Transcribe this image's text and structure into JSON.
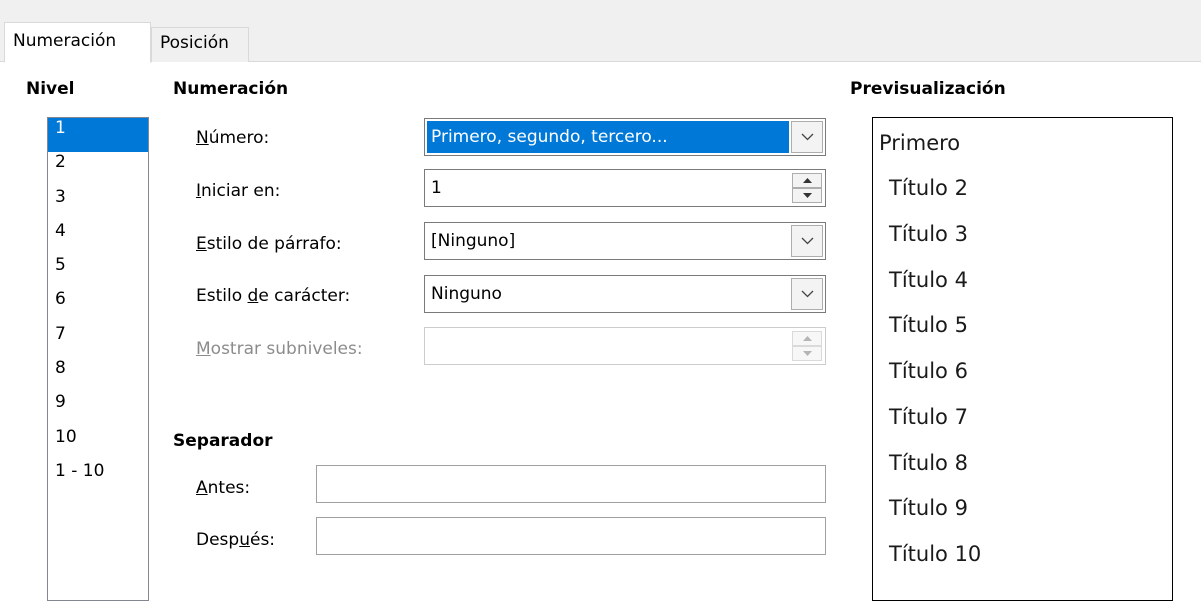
{
  "tabs": [
    {
      "label": "Numeración",
      "active": true
    },
    {
      "label": "Posición",
      "active": false
    }
  ],
  "level": {
    "heading": "Nivel",
    "items": [
      "1",
      "2",
      "3",
      "4",
      "5",
      "6",
      "7",
      "8",
      "9",
      "10",
      "1 - 10"
    ],
    "selected": "1"
  },
  "numbering": {
    "heading": "Numeración",
    "number": {
      "label_u": "N",
      "label_rest": "úmero:",
      "value": "Primero, segundo, tercero..."
    },
    "start_at": {
      "label_u": "I",
      "label_rest": "niciar en:",
      "value": "1"
    },
    "paragraph_style": {
      "label_u": "E",
      "label_rest": "stilo de párrafo:",
      "value": "[Ninguno]"
    },
    "character_style": {
      "label_pre": "Estilo ",
      "label_u": "d",
      "label_rest": "e carácter:",
      "value": "Ninguno"
    },
    "show_sublevels": {
      "label_u": "M",
      "label_rest": "ostrar subniveles:",
      "value": "",
      "disabled": true
    }
  },
  "separator": {
    "heading": "Separador",
    "before": {
      "label_u": "A",
      "label_rest": "ntes:",
      "value": ""
    },
    "after": {
      "label_pre": "Desp",
      "label_u": "u",
      "label_rest": "és:",
      "value": ""
    }
  },
  "preview": {
    "heading": "Previsualización",
    "items": [
      "Primero",
      "Título 2",
      "Título 3",
      "Título 4",
      "Título 5",
      "Título 6",
      "Título 7",
      "Título 8",
      "Título 9",
      "Título 10"
    ]
  },
  "colors": {
    "selection": "#0078d7",
    "disabled_text": "#8c8c8c"
  }
}
